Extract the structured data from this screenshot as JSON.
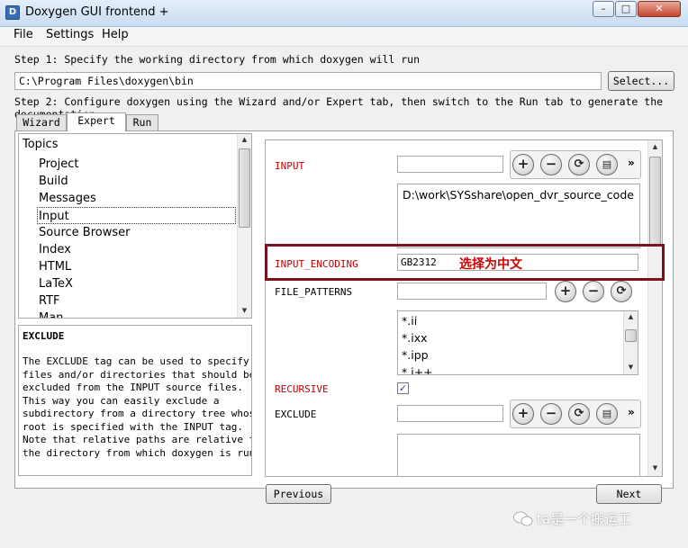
{
  "window": {
    "title": "Doxygen GUI frontend +",
    "minimize": "–",
    "maximize": "□",
    "close": "✕"
  },
  "menu": {
    "file": "File",
    "settings": "Settings",
    "help": "Help"
  },
  "step1": {
    "text": "Step 1: Specify the working directory from which doxygen will run",
    "dir_value": "C:\\Program Files\\doxygen\\bin",
    "select_label": "Select..."
  },
  "step2": {
    "text": "Step 2: Configure doxygen using the Wizard and/or Expert tab, then switch to the Run tab to generate the documentation"
  },
  "tabs": {
    "wizard": "Wizard",
    "expert": "Expert",
    "run": "Run"
  },
  "topics": {
    "header": "Topics",
    "items": [
      "Project",
      "Build",
      "Messages",
      "Input",
      "Source Browser",
      "Index",
      "HTML",
      "LaTeX",
      "RTF",
      "Man"
    ],
    "selected": "Input"
  },
  "help": {
    "title": "EXCLUDE",
    "text": "The EXCLUDE tag can be used to specify\nfiles and/or directories that should be\nexcluded from the INPUT source files.\nThis way you can easily exclude a\nsubdirectory from a directory tree whose\nroot is specified with the INPUT tag.\nNote that relative paths are relative to\nthe directory from which doxygen is run."
  },
  "settings": {
    "input": {
      "label": "INPUT",
      "value": "",
      "list": [
        "D:\\work\\SYSshare\\open_dvr_source_code"
      ]
    },
    "input_encoding": {
      "label": "INPUT_ENCODING",
      "value": "GB2312"
    },
    "file_patterns": {
      "label": "FILE_PATTERNS",
      "value": "",
      "list": [
        "*.ii",
        "*.ixx",
        "*.ipp",
        "*.i++"
      ]
    },
    "recursive": {
      "label": "RECURSIVE",
      "checked": true,
      "check_glyph": "✓"
    },
    "exclude": {
      "label": "EXCLUDE",
      "value": ""
    }
  },
  "buttons": {
    "plus": "+",
    "minus": "−",
    "refresh": "⟳",
    "file": "▤",
    "more": "»"
  },
  "annotation": "选择为中文",
  "nav": {
    "previous": "Previous",
    "next": "Next"
  },
  "watermark": "ta是一个搬运工",
  "colors": {
    "required_label": "#c00000",
    "highlight_box": "#7a1020",
    "annotation": "#d40000"
  }
}
